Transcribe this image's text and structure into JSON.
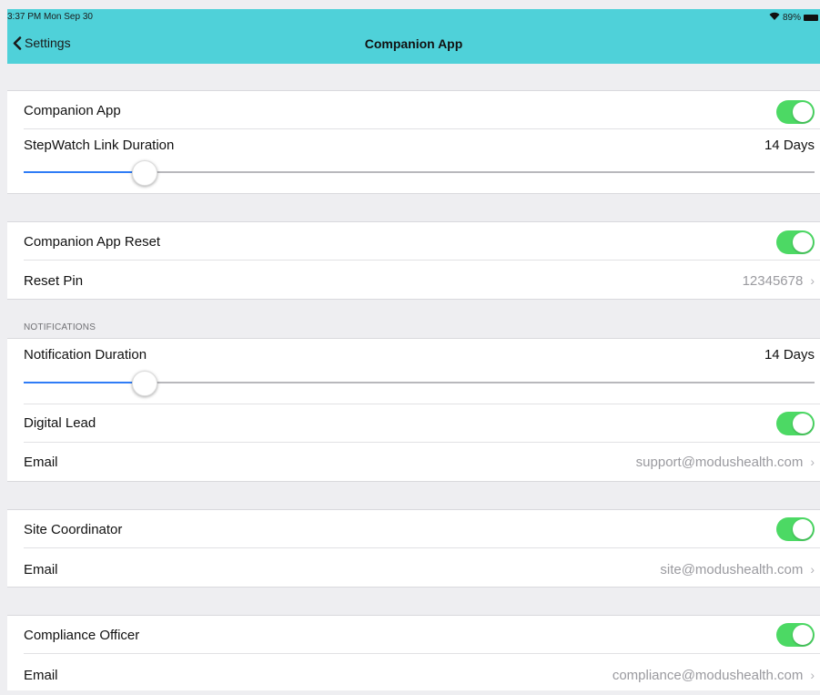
{
  "status_bar": {
    "time_date": "3:37 PM  Mon Sep 30",
    "wifi_icon": "wifi-icon",
    "battery": "89%"
  },
  "nav": {
    "back_label": "Settings",
    "title": "Companion App"
  },
  "colors": {
    "nav_bar": "#4fd1d9",
    "toggle_on": "#4cd964",
    "slider_fill": "#2f7cf6"
  },
  "rows": {
    "companion_app": {
      "label": "Companion App",
      "toggle": true
    },
    "link_duration": {
      "label": "StepWatch Link Duration",
      "value": "14 Days",
      "slider_fraction": 0.152
    },
    "companion_reset": {
      "label": "Companion App Reset",
      "toggle": true
    },
    "reset_pin": {
      "label": "Reset Pin",
      "value": "12345678"
    },
    "notifications_header": "NOTIFICATIONS",
    "notification_duration": {
      "label": "Notification Duration",
      "value": "14 Days",
      "slider_fraction": 0.152
    },
    "digital_lead": {
      "label": "Digital Lead",
      "toggle": true
    },
    "digital_lead_email": {
      "label": "Email",
      "value": "support@modushealth.com"
    },
    "site_coordinator": {
      "label": "Site Coordinator",
      "toggle": true
    },
    "site_coordinator_email": {
      "label": "Email",
      "value": "site@modushealth.com"
    },
    "compliance_officer": {
      "label": "Compliance Officer",
      "toggle": true
    },
    "compliance_officer_email": {
      "label": "Email",
      "value": "compliance@modushealth.com"
    }
  },
  "chevron": "›"
}
